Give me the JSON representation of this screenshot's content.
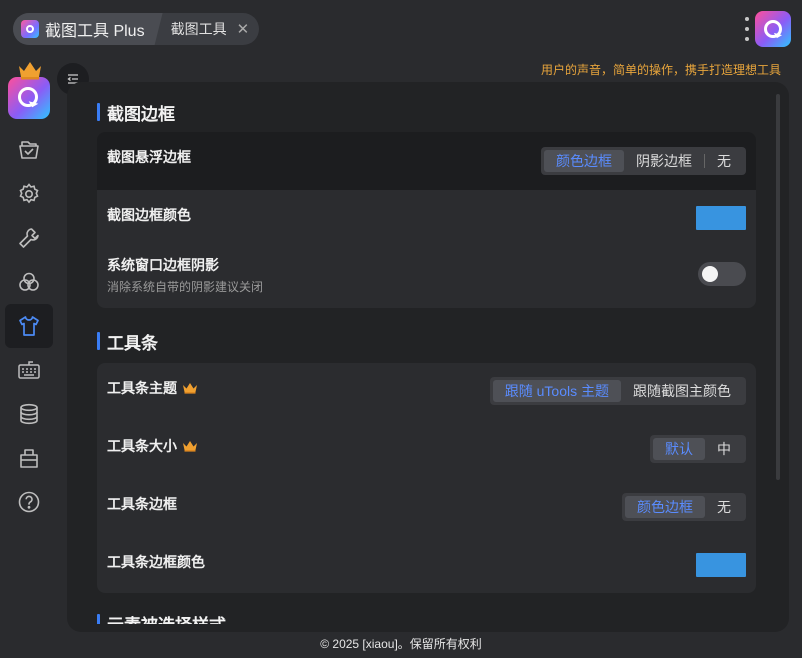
{
  "header": {
    "app_title": "截图工具 Plus",
    "tab_label": "截图工具",
    "close_symbol": "✕",
    "slogan": "用户的声音，简单的操作，携手打造理想工具"
  },
  "sidebar": {
    "items": [
      {
        "icon": "folder-open-icon",
        "active": false
      },
      {
        "icon": "gear-icon",
        "active": false
      },
      {
        "icon": "wrench-icon",
        "active": false
      },
      {
        "icon": "color-circles-icon",
        "active": false
      },
      {
        "icon": "shirt-icon",
        "active": true
      },
      {
        "icon": "keyboard-icon",
        "active": false
      },
      {
        "icon": "database-icon",
        "active": false
      },
      {
        "icon": "shop-icon",
        "active": false
      },
      {
        "icon": "help-icon",
        "active": false
      }
    ]
  },
  "colors": {
    "accent": "#3a7df5",
    "selected_text": "#5a8cff",
    "swatch": "#3894e0",
    "premium": "#e8a53c"
  },
  "sections": {
    "border": {
      "title": "截图边框",
      "float_border": {
        "label": "截图悬浮边框",
        "options": [
          "颜色边框",
          "阴影边框",
          "无"
        ],
        "selected": "颜色边框"
      },
      "border_color": {
        "label": "截图边框颜色",
        "value": "#3894e0"
      },
      "window_shadow": {
        "label": "系统窗口边框阴影",
        "desc": "消除系统自带的阴影建议关闭",
        "enabled": false
      }
    },
    "toolbar": {
      "title": "工具条",
      "theme": {
        "label": "工具条主题",
        "options": [
          "跟随 uTools 主题",
          "跟随截图主颜色"
        ],
        "selected": "跟随 uTools 主题"
      },
      "size": {
        "label": "工具条大小",
        "options": [
          "默认",
          "中"
        ],
        "selected": "默认"
      },
      "border": {
        "label": "工具条边框",
        "options": [
          "颜色边框",
          "无"
        ],
        "selected": "颜色边框"
      },
      "border_color": {
        "label": "工具条边框颜色",
        "value": "#3894e0"
      }
    },
    "next_partial": {
      "title": "元素被选择样式"
    }
  },
  "footer": {
    "copyright": "© 2025 [xiaou]。保留所有权利"
  }
}
